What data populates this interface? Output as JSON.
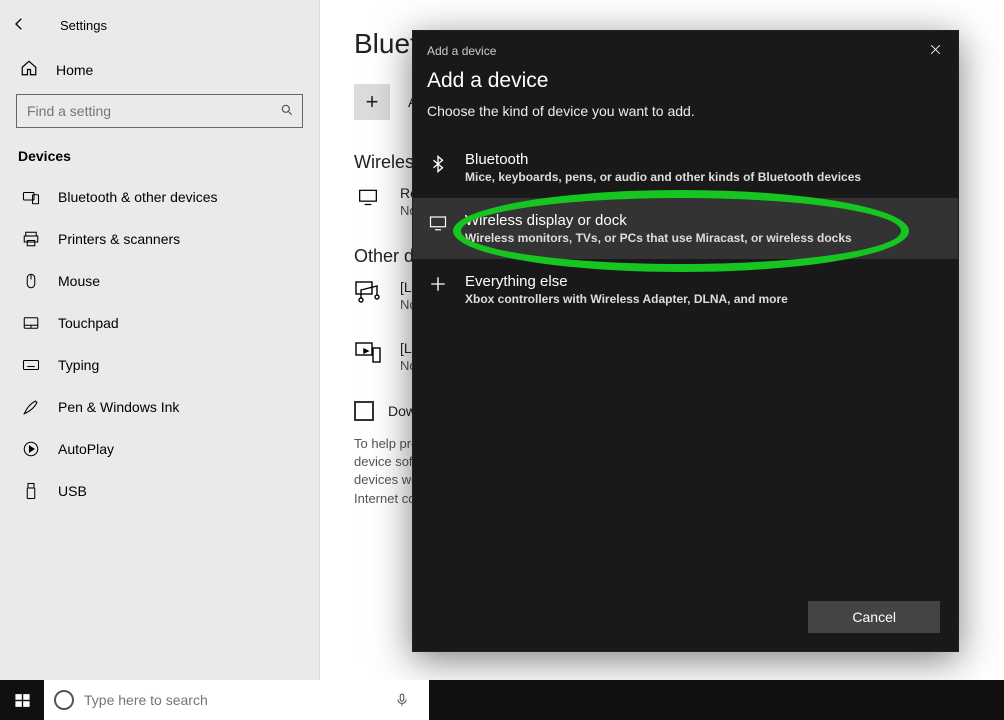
{
  "header": {
    "app_name": "Settings"
  },
  "sidebar": {
    "home_label": "Home",
    "search_placeholder": "Find a setting",
    "category": "Devices",
    "items": [
      {
        "label": "Bluetooth & other devices"
      },
      {
        "label": "Printers & scanners"
      },
      {
        "label": "Mouse"
      },
      {
        "label": "Touchpad"
      },
      {
        "label": "Typing"
      },
      {
        "label": "Pen & Windows Ink"
      },
      {
        "label": "AutoPlay"
      },
      {
        "label": "USB"
      }
    ]
  },
  "main": {
    "title": "Bluetooth & other devices",
    "add_label": "Add Bluetooth or other device",
    "section_wireless": "Wireless displays & docks",
    "device_roku": {
      "name": "Roku",
      "sub": "Not connected"
    },
    "section_other": "Other devices",
    "device_lg1": {
      "name": "[LG webOS TV",
      "sub": "Not connected"
    },
    "device_lg2": {
      "name": "[LG webOS TV",
      "sub": "Not connected"
    },
    "metered_label": "Download over metered connections",
    "metered_help": "To help prevent extra charges, keep this off so device software (drivers, info, and apps) for new devices won't download while you're on metered Internet connections."
  },
  "dialog": {
    "caption": "Add a device",
    "title": "Add a device",
    "subtitle": "Choose the kind of device you want to add.",
    "options": [
      {
        "title": "Bluetooth",
        "sub": "Mice, keyboards, pens, or audio and other kinds of Bluetooth devices"
      },
      {
        "title": "Wireless display or dock",
        "sub": "Wireless monitors, TVs, or PCs that use Miracast, or wireless docks"
      },
      {
        "title": "Everything else",
        "sub": "Xbox controllers with Wireless Adapter, DLNA, and more"
      }
    ],
    "cancel": "Cancel"
  },
  "taskbar": {
    "search_placeholder": "Type here to search"
  }
}
